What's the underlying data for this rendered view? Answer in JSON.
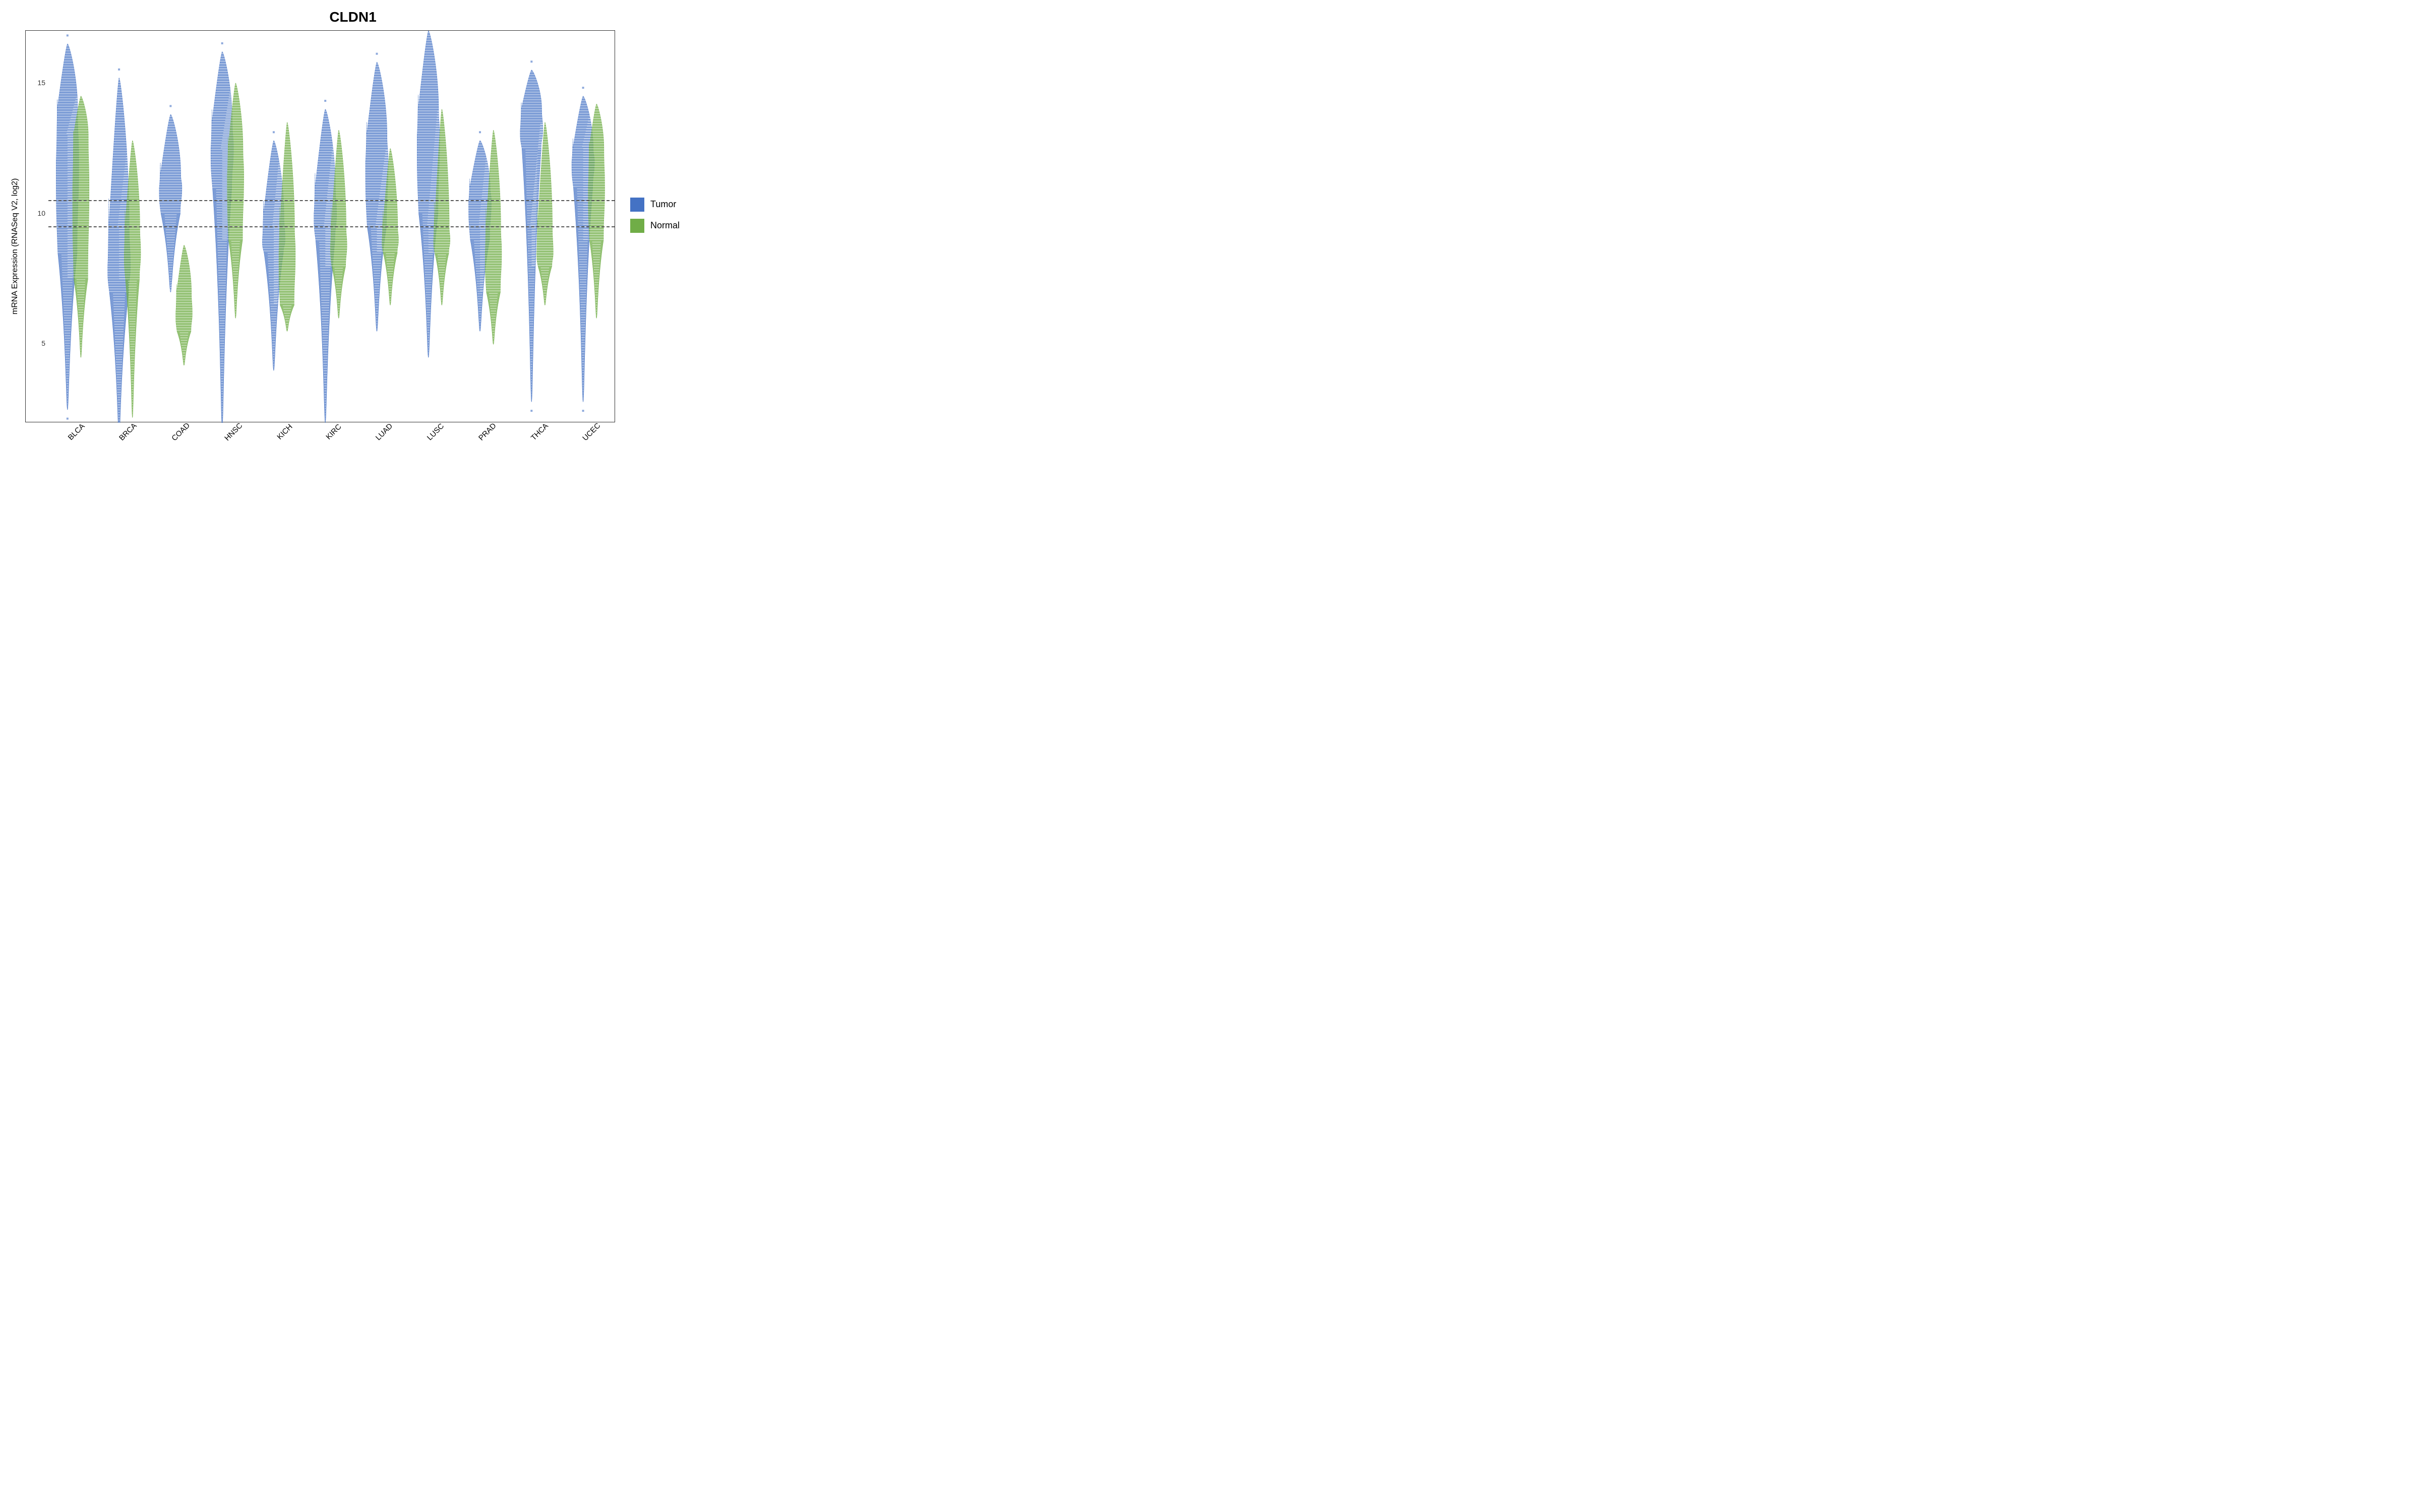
{
  "title": "CLDN1",
  "yAxisLabel": "mRNA Expression (RNASeq V2, log2)",
  "yTicks": [
    5,
    10,
    15
  ],
  "yMin": 2,
  "yMax": 17,
  "dashedLines": [
    10.5,
    9.5
  ],
  "xLabels": [
    "BLCA",
    "BRCA",
    "COAD",
    "HNSC",
    "KICH",
    "KIRC",
    "LUAD",
    "LUSC",
    "PRAD",
    "THCA",
    "UCEC"
  ],
  "legend": {
    "items": [
      {
        "label": "Tumor",
        "color": "#4472C4"
      },
      {
        "label": "Normal",
        "color": "#70AD47"
      }
    ]
  },
  "violins": [
    {
      "cancer": "BLCA",
      "tumor": {
        "top": 16.5,
        "q3": 14,
        "median": 12,
        "q1": 8.5,
        "bottom": 2.5,
        "width": 0.55
      },
      "normal": {
        "top": 14.5,
        "q3": 13,
        "median": 11,
        "q1": 7.5,
        "bottom": 4.5,
        "width": 0.4
      }
    },
    {
      "cancer": "BRCA",
      "tumor": {
        "top": 15.2,
        "q3": 9.5,
        "median": 8,
        "q1": 7,
        "bottom": 1.5,
        "width": 0.45
      },
      "normal": {
        "top": 12.8,
        "q3": 9.5,
        "median": 8.5,
        "q1": 7.5,
        "bottom": 2.2,
        "width": 0.5
      }
    },
    {
      "cancer": "COAD",
      "tumor": {
        "top": 13.8,
        "q3": 11.5,
        "median": 11,
        "q1": 10,
        "bottom": 7,
        "width": 0.5
      },
      "normal": {
        "top": 8.8,
        "q3": 7,
        "median": 6.2,
        "q1": 5.5,
        "bottom": 4.2,
        "width": 0.45
      }
    },
    {
      "cancer": "HNSC",
      "tumor": {
        "top": 16.2,
        "q3": 13.5,
        "median": 12.5,
        "q1": 11,
        "bottom": 1.8,
        "width": 0.55
      },
      "normal": {
        "top": 15,
        "q3": 12.5,
        "median": 11.5,
        "q1": 9,
        "bottom": 6,
        "width": 0.45
      }
    },
    {
      "cancer": "KICH",
      "tumor": {
        "top": 12.8,
        "q3": 10,
        "median": 9,
        "q1": 8.5,
        "bottom": 4,
        "width": 0.4
      },
      "normal": {
        "top": 13.5,
        "q3": 9.5,
        "median": 8.5,
        "q1": 6.5,
        "bottom": 5.5,
        "width": 0.45
      }
    },
    {
      "cancer": "KIRC",
      "tumor": {
        "top": 14,
        "q3": 11,
        "median": 10,
        "q1": 9,
        "bottom": 2,
        "width": 0.45
      },
      "normal": {
        "top": 13.2,
        "q3": 9.5,
        "median": 8.8,
        "q1": 8,
        "bottom": 6,
        "width": 0.4
      }
    },
    {
      "cancer": "LUAD",
      "tumor": {
        "top": 15.8,
        "q3": 13,
        "median": 12,
        "q1": 9.5,
        "bottom": 5.5,
        "width": 0.5
      },
      "normal": {
        "top": 12.5,
        "q3": 9.5,
        "median": 9,
        "q1": 8.5,
        "bottom": 6.5,
        "width": 0.4
      }
    },
    {
      "cancer": "LUSC",
      "tumor": {
        "top": 17,
        "q3": 14,
        "median": 13,
        "q1": 10,
        "bottom": 4.5,
        "width": 0.55
      },
      "normal": {
        "top": 14,
        "q3": 9.5,
        "median": 9,
        "q1": 8.5,
        "bottom": 6.5,
        "width": 0.4
      }
    },
    {
      "cancer": "PRAD",
      "tumor": {
        "top": 12.8,
        "q3": 11,
        "median": 10.5,
        "q1": 9,
        "bottom": 5.5,
        "width": 0.4
      },
      "normal": {
        "top": 13.2,
        "q3": 9.5,
        "median": 8.5,
        "q1": 7,
        "bottom": 5,
        "width": 0.45
      }
    },
    {
      "cancer": "THCA",
      "tumor": {
        "top": 15.5,
        "q3": 14,
        "median": 13.2,
        "q1": 12.5,
        "bottom": 2.8,
        "width": 0.5
      },
      "normal": {
        "top": 13.5,
        "q3": 9.5,
        "median": 8.5,
        "q1": 8,
        "bottom": 6.5,
        "width": 0.4
      }
    },
    {
      "cancer": "UCEC",
      "tumor": {
        "top": 14.5,
        "q3": 12.5,
        "median": 12,
        "q1": 11,
        "bottom": 2.8,
        "width": 0.5
      },
      "normal": {
        "top": 14.2,
        "q3": 12.5,
        "median": 11,
        "q1": 9,
        "bottom": 6,
        "width": 0.45
      }
    }
  ]
}
